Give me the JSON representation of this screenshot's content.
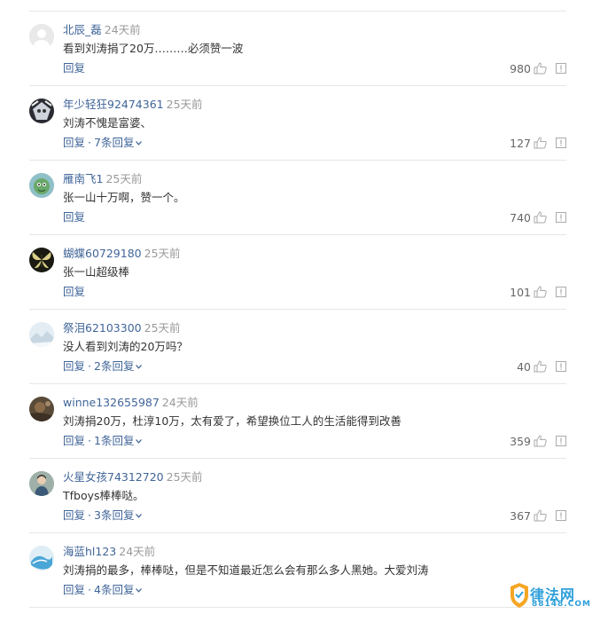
{
  "comments": [
    {
      "user": "北辰_磊",
      "time": "24天前",
      "text": "看到刘涛捐了20万………必须赞一波",
      "reply": "回复",
      "more": "",
      "likes": "980",
      "avatar": "default"
    },
    {
      "user": "年少轻狂92474361",
      "time": "25天前",
      "text": "刘涛不愧是富婆、",
      "reply": "回复",
      "more": "7条回复",
      "likes": "127",
      "avatar": "anime-dark"
    },
    {
      "user": "雁南飞1",
      "time": "25天前",
      "text": "张一山十万啊，赞一个。",
      "reply": "回复",
      "more": "",
      "likes": "740",
      "avatar": "green-cartoon"
    },
    {
      "user": "蝴蝶60729180",
      "time": "25天前",
      "text": "张一山超级棒",
      "reply": "回复",
      "more": "",
      "likes": "101",
      "avatar": "butterfly"
    },
    {
      "user": "祭泪62103300",
      "time": "25天前",
      "text": "没人看到刘涛的20万吗？",
      "reply": "回复",
      "more": "2条回复",
      "likes": "40",
      "avatar": "snow-landscape"
    },
    {
      "user": "winne132655987",
      "time": "24天前",
      "text": "刘涛捐20万，杜淳10万，太有爱了，希望换位工人的生活能得到改善",
      "reply": "回复",
      "more": "1条回复",
      "likes": "359",
      "avatar": "brown-photo"
    },
    {
      "user": "火星女孩74312720",
      "time": "25天前",
      "text": "Tfboys棒棒哒。",
      "reply": "回复",
      "more": "3条回复",
      "likes": "367",
      "avatar": "person-photo"
    },
    {
      "user": "海蓝hl123",
      "time": "24天前",
      "text": "刘涛捐的最多，棒棒哒，但是不知道最近怎么会有那么多人黑她。大爱刘涛",
      "reply": "回复",
      "more": "4条回复",
      "likes": "",
      "avatar": "blue-wave"
    }
  ],
  "ui": {
    "separator": "·"
  },
  "watermark": {
    "title": "律法网",
    "url": "88148.COM"
  },
  "colors": {
    "link": "#406599",
    "muted": "#999999",
    "divider": "#e6e6e6",
    "watermark": "#2fa0da"
  }
}
